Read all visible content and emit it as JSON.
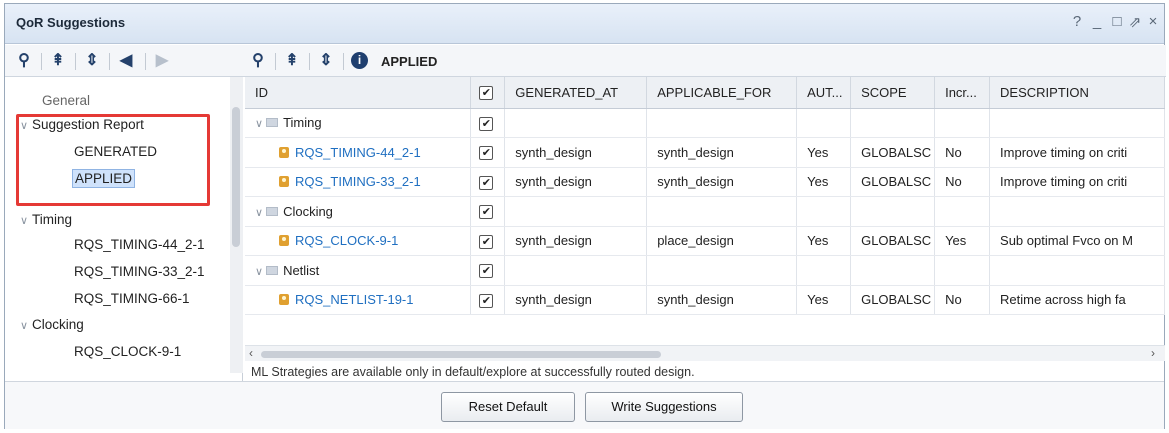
{
  "window": {
    "title": "QoR Suggestions",
    "controls": [
      "?",
      "_",
      "□",
      "⇗",
      "×"
    ]
  },
  "left_toolbar": {
    "icons": [
      "search-icon",
      "collapse-all-icon",
      "expand-all-icon",
      "back-arrow-icon",
      "forward-arrow-icon"
    ]
  },
  "right_toolbar": {
    "icons": [
      "search-icon",
      "collapse-all-icon",
      "expand-all-icon",
      "info-icon"
    ],
    "label": "APPLIED"
  },
  "tree": {
    "items": [
      {
        "label": "General"
      },
      {
        "label": "Suggestion Report"
      },
      {
        "label": "GENERATED"
      },
      {
        "label": "APPLIED"
      },
      {
        "label": "Timing"
      },
      {
        "label": "RQS_TIMING-44_2-1"
      },
      {
        "label": "RQS_TIMING-33_2-1"
      },
      {
        "label": "RQS_TIMING-66-1"
      },
      {
        "label": "Clocking"
      },
      {
        "label": "RQS_CLOCK-9-1"
      }
    ]
  },
  "table": {
    "columns": [
      "ID",
      "",
      "GENERATED_AT",
      "APPLICABLE_FOR",
      "AUT...",
      "SCOPE",
      "Incr...",
      "DESCRIPTION"
    ],
    "rows": [
      {
        "id": "Timing",
        "group": true
      },
      {
        "id": "RQS_TIMING-44_2-1",
        "generated_at": "synth_design",
        "applicable_for": "synth_design",
        "auto": "Yes",
        "scope": "GLOBALSC",
        "incr": "No",
        "description": "Improve timing on criti"
      },
      {
        "id": "RQS_TIMING-33_2-1",
        "generated_at": "synth_design",
        "applicable_for": "synth_design",
        "auto": "Yes",
        "scope": "GLOBALSC",
        "incr": "No",
        "description": "Improve timing on criti"
      },
      {
        "id": "Clocking",
        "group": true
      },
      {
        "id": "RQS_CLOCK-9-1",
        "generated_at": "synth_design",
        "applicable_for": "place_design",
        "auto": "Yes",
        "scope": "GLOBALSC",
        "incr": "Yes",
        "description": "Sub optimal Fvco on M"
      },
      {
        "id": "Netlist",
        "group": true
      },
      {
        "id": "RQS_NETLIST-19-1",
        "generated_at": "synth_design",
        "applicable_for": "synth_design",
        "auto": "Yes",
        "scope": "GLOBALSC",
        "incr": "No",
        "description": "Retime across high fa"
      }
    ]
  },
  "note": "ML Strategies are available only in default/explore at successfully routed design.",
  "buttons": {
    "reset": "Reset Default",
    "write": "Write Suggestions"
  }
}
